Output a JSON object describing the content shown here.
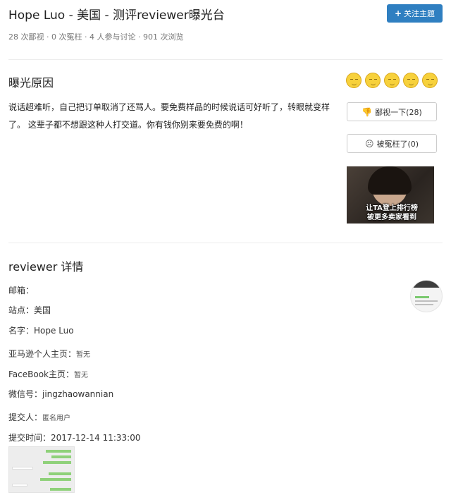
{
  "header": {
    "title": "Hope Luo - 美国 - 测评reviewer曝光台",
    "follow_button": "关注主题",
    "stats": "28 次鄙视 · 0 次冤枉 · 4 人参与讨论 · 901 次浏览"
  },
  "reason": {
    "heading": "曝光原因",
    "text": "说话超难听，自己把订单取消了还骂人。要免费样品的时候说话可好听了，转眼就变样了。 这辈子都不想跟这种人打交道。你有钱你别来要免费的啊！"
  },
  "sidebar": {
    "despise_button": "鄙视一下(28)",
    "wronged_button": "被冤枉了(0)",
    "ad_line1": "让TA登上排行榜",
    "ad_line2": "被更多卖家看到"
  },
  "details": {
    "heading": "reviewer 详情",
    "email_label": "邮箱：",
    "site_label": "站点：",
    "site_value": "美国",
    "name_label": "名字：",
    "name_value": "Hope Luo",
    "amazon_label": "亚马逊个人主页：",
    "amazon_value": "暂无",
    "facebook_label": "FaceBook主页：",
    "facebook_value": "暂无",
    "wechat_label": "微信号：",
    "wechat_value": "jingzhaowannian",
    "submitter_label": "提交人：",
    "submitter_value": "匿名用户",
    "submit_time_label": "提交时间：",
    "submit_time_value": "2017-12-14 11:33:00"
  },
  "icons": {
    "follow": "plus-icon",
    "despise": "thumbs-down-icon",
    "wronged": "sad-face-icon",
    "faces": "face-icon"
  },
  "colors": {
    "accent": "#2f7fc1",
    "face": "#f7d13c"
  }
}
